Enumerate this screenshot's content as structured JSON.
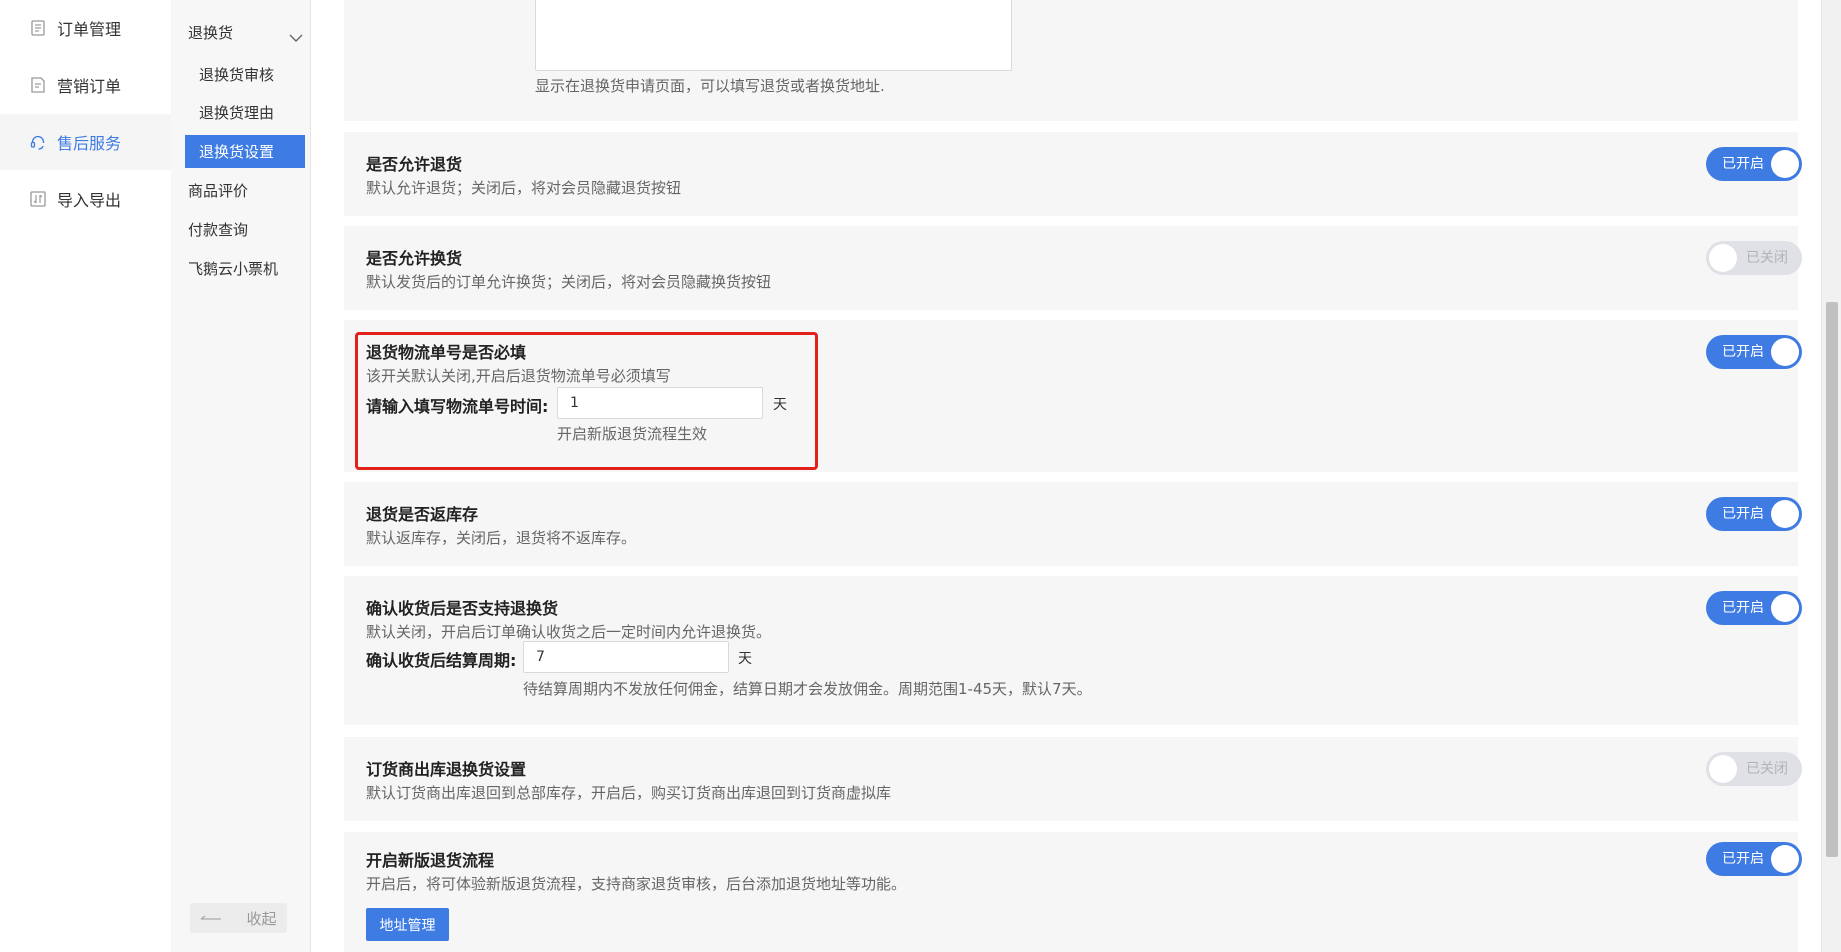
{
  "nav1": {
    "items": [
      {
        "label": "订单管理",
        "icon": "document-icon",
        "active": false
      },
      {
        "label": "营销订单",
        "icon": "receipt-icon",
        "active": false
      },
      {
        "label": "售后服务",
        "icon": "headset-icon",
        "active": true
      },
      {
        "label": "导入导出",
        "icon": "import-export-icon",
        "active": false
      }
    ]
  },
  "nav2": {
    "group_label": "退换货",
    "sub_items": [
      "退换货审核",
      "退换货理由",
      "退换货设置"
    ],
    "active_sub": "退换货设置",
    "top_items": [
      "商品评价",
      "付款查询",
      "飞鹅云小票机"
    ],
    "collapse_label": "收起"
  },
  "settings": {
    "address_hint": "显示在退换货申请页面，可以填写退货或者换货地址.",
    "allow_return": {
      "title": "是否允许退货",
      "desc": "默认允许退货；关闭后，将对会员隐藏退货按钮",
      "state": "已开启"
    },
    "allow_exchange": {
      "title": "是否允许换货",
      "desc": "默认发货后的订单允许换货；关闭后，将对会员隐藏换货按钮",
      "state": "已关闭"
    },
    "logistics_required": {
      "title": "退货物流单号是否必填",
      "desc": "该开关默认关闭,开启后退货物流单号必须填写",
      "field_label": "请输入填写物流单号时间:",
      "field_value": "1",
      "unit": "天",
      "hint": "开启新版退货流程生效",
      "state": "已开启"
    },
    "return_to_stock": {
      "title": "退货是否返库存",
      "desc": "默认返库存，关闭后，退货将不返库存。",
      "state": "已开启"
    },
    "after_receipt": {
      "title": "确认收货后是否支持退换货",
      "desc": "默认关闭，开启后订单确认收货之后一定时间内允许退换货。",
      "field_label": "确认收货后结算周期:",
      "field_value": "7",
      "unit": "天",
      "hint": "待结算周期内不发放任何佣金，结算日期才会发放佣金。周期范围1-45天，默认7天。",
      "state": "已开启"
    },
    "distributor_return": {
      "title": "订货商出库退换货设置",
      "desc": "默认订货商出库退回到总部库存，开启后，购买订货商出库退回到订货商虚拟库",
      "state": "已关闭"
    },
    "new_flow": {
      "title": "开启新版退货流程",
      "desc": "开启后，将可体验新版退货流程，支持商家退货审核，后台添加退货地址等功能。",
      "state": "已开启",
      "button_label": "地址管理"
    }
  },
  "colors": {
    "accent": "#3e7ce4",
    "highlight": "#e3211c",
    "toggle_off": "#dfe1e6"
  }
}
